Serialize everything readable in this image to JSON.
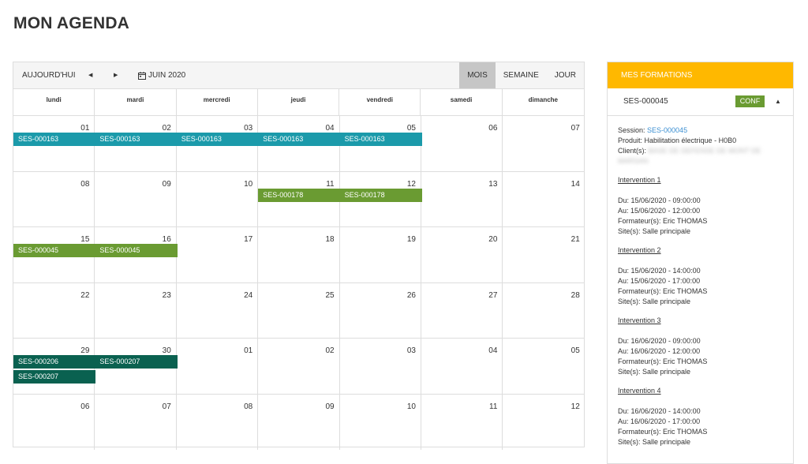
{
  "page_title": "MON AGENDA",
  "toolbar": {
    "today": "AUJOURD'HUI",
    "prev": "◀",
    "next": "▶",
    "month_label": "JUIN 2020",
    "views": [
      "MOIS",
      "SEMAINE",
      "JOUR"
    ],
    "active_view": "MOIS"
  },
  "weekdays": [
    "lundi",
    "mardi",
    "mercredi",
    "jeudi",
    "vendredi",
    "samedi",
    "dimanche"
  ],
  "weeks": [
    {
      "days": [
        "01",
        "02",
        "03",
        "04",
        "05",
        "06",
        "07"
      ],
      "events": [
        {
          "label": "SES-000163",
          "start": 0,
          "span": 1,
          "row": 0,
          "color": "#1b9aaa"
        },
        {
          "label": "SES-000163",
          "start": 1,
          "span": 1,
          "row": 0,
          "color": "#1b9aaa"
        },
        {
          "label": "SES-000163",
          "start": 2,
          "span": 1,
          "row": 0,
          "color": "#1b9aaa"
        },
        {
          "label": "SES-000163",
          "start": 3,
          "span": 1,
          "row": 0,
          "color": "#1b9aaa"
        },
        {
          "label": "SES-000163",
          "start": 4,
          "span": 1,
          "row": 0,
          "color": "#1b9aaa"
        }
      ]
    },
    {
      "days": [
        "08",
        "09",
        "10",
        "11",
        "12",
        "13",
        "14"
      ],
      "events": [
        {
          "label": "SES-000178",
          "start": 3,
          "span": 1,
          "row": 0,
          "color": "#6a9b32"
        },
        {
          "label": "SES-000178",
          "start": 4,
          "span": 1,
          "row": 0,
          "color": "#6a9b32"
        }
      ]
    },
    {
      "days": [
        "15",
        "16",
        "17",
        "18",
        "19",
        "20",
        "21"
      ],
      "events": [
        {
          "label": "SES-000045",
          "start": 0,
          "span": 1,
          "row": 0,
          "color": "#6a9b32"
        },
        {
          "label": "SES-000045",
          "start": 1,
          "span": 1,
          "row": 0,
          "color": "#6a9b32"
        }
      ]
    },
    {
      "days": [
        "22",
        "23",
        "24",
        "25",
        "26",
        "27",
        "28"
      ],
      "events": []
    },
    {
      "days": [
        "29",
        "30",
        "01",
        "02",
        "03",
        "04",
        "05"
      ],
      "events": [
        {
          "label": "SES-000206",
          "start": 0,
          "span": 1,
          "row": 0,
          "color": "#0a6150"
        },
        {
          "label": "SES-000207",
          "start": 1,
          "span": 1,
          "row": 0,
          "color": "#0a6150"
        },
        {
          "label": "SES-000207",
          "start": 0,
          "span": 1,
          "row": 1,
          "color": "#0a6150"
        }
      ]
    },
    {
      "days": [
        "06",
        "07",
        "08",
        "09",
        "10",
        "11",
        "12"
      ],
      "events": []
    }
  ],
  "panel": {
    "header": "MES FORMATIONS",
    "session_code": "SES-000045",
    "badge": "CONF",
    "caret": "▲",
    "session_label": "Session: ",
    "session_link": "SES-000045",
    "product": "Produit: Habilitation électrique - H0B0",
    "client_label": "Client(s): ",
    "client_value": "BASE DE DEFENSE DE MONT DE",
    "client_value2": "MARSAN",
    "interventions": [
      {
        "title": "Intervention 1",
        "du": "Du: 15/06/2020 - 09:00:00",
        "au": "Au: 15/06/2020 - 12:00:00",
        "formateur": "Formateur(s): Eric THOMAS",
        "site": "Site(s): Salle principale"
      },
      {
        "title": "Intervention 2",
        "du": "Du: 15/06/2020 - 14:00:00",
        "au": "Au: 15/06/2020 - 17:00:00",
        "formateur": "Formateur(s): Eric THOMAS",
        "site": "Site(s): Salle principale"
      },
      {
        "title": "Intervention 3",
        "du": "Du: 16/06/2020 - 09:00:00",
        "au": "Au: 16/06/2020 - 12:00:00",
        "formateur": "Formateur(s): Eric THOMAS",
        "site": "Site(s): Salle principale"
      },
      {
        "title": "Intervention 4",
        "du": "Du: 16/06/2020 - 14:00:00",
        "au": "Au: 16/06/2020 - 17:00:00",
        "formateur": "Formateur(s): Eric THOMAS",
        "site": "Site(s): Salle principale"
      }
    ]
  }
}
